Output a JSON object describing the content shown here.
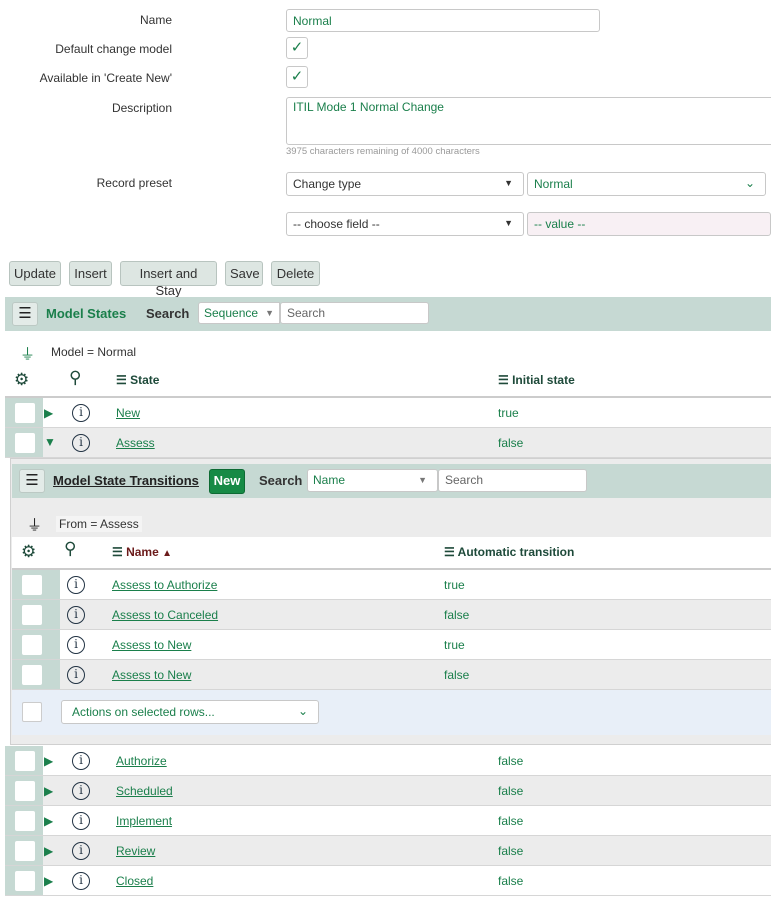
{
  "form": {
    "name_label": "Name",
    "name_value": "Normal",
    "default_label": "Default change model",
    "default_checked": true,
    "available_label": "Available in 'Create New'",
    "available_checked": true,
    "description_label": "Description",
    "description_value": "ITIL Mode 1 Normal Change",
    "char_counter": "3975 characters remaining of 4000 characters",
    "preset_label": "Record preset",
    "preset_field": "Change type",
    "preset_value": "Normal",
    "choose_field": "-- choose field --",
    "value_placeholder": "-- value --",
    "check_glyph": "✓"
  },
  "buttons": {
    "update": "Update",
    "insert": "Insert",
    "insert_stay": "Insert and Stay",
    "save": "Save",
    "delete": "Delete"
  },
  "model_states": {
    "title": "Model States",
    "search_label": "Search",
    "search_field": "Sequence",
    "search_placeholder": "Search",
    "filter": "Model = Normal",
    "col_state": "State",
    "col_initial": "Initial state",
    "rows_top": [
      {
        "state": "New",
        "initial": "true",
        "expanded": false
      },
      {
        "state": "Assess",
        "initial": "false",
        "expanded": true
      }
    ],
    "rows_bottom": [
      {
        "state": "Authorize",
        "initial": "false"
      },
      {
        "state": "Scheduled",
        "initial": "false"
      },
      {
        "state": "Implement",
        "initial": "false"
      },
      {
        "state": "Review",
        "initial": "false"
      },
      {
        "state": "Closed",
        "initial": "false"
      }
    ]
  },
  "transitions": {
    "title": "Model State Transitions",
    "new_label": "New",
    "search_label": "Search",
    "search_field": "Name",
    "search_placeholder": "Search",
    "filter": "From = Assess",
    "col_name": "Name",
    "col_auto": "Automatic transition",
    "rows": [
      {
        "name": "Assess to Authorize",
        "auto": "true"
      },
      {
        "name": "Assess to Canceled",
        "auto": "false"
      },
      {
        "name": "Assess to New",
        "auto": "true"
      },
      {
        "name": "Assess to New",
        "auto": "false"
      }
    ],
    "actions_placeholder": "Actions on selected rows..."
  }
}
